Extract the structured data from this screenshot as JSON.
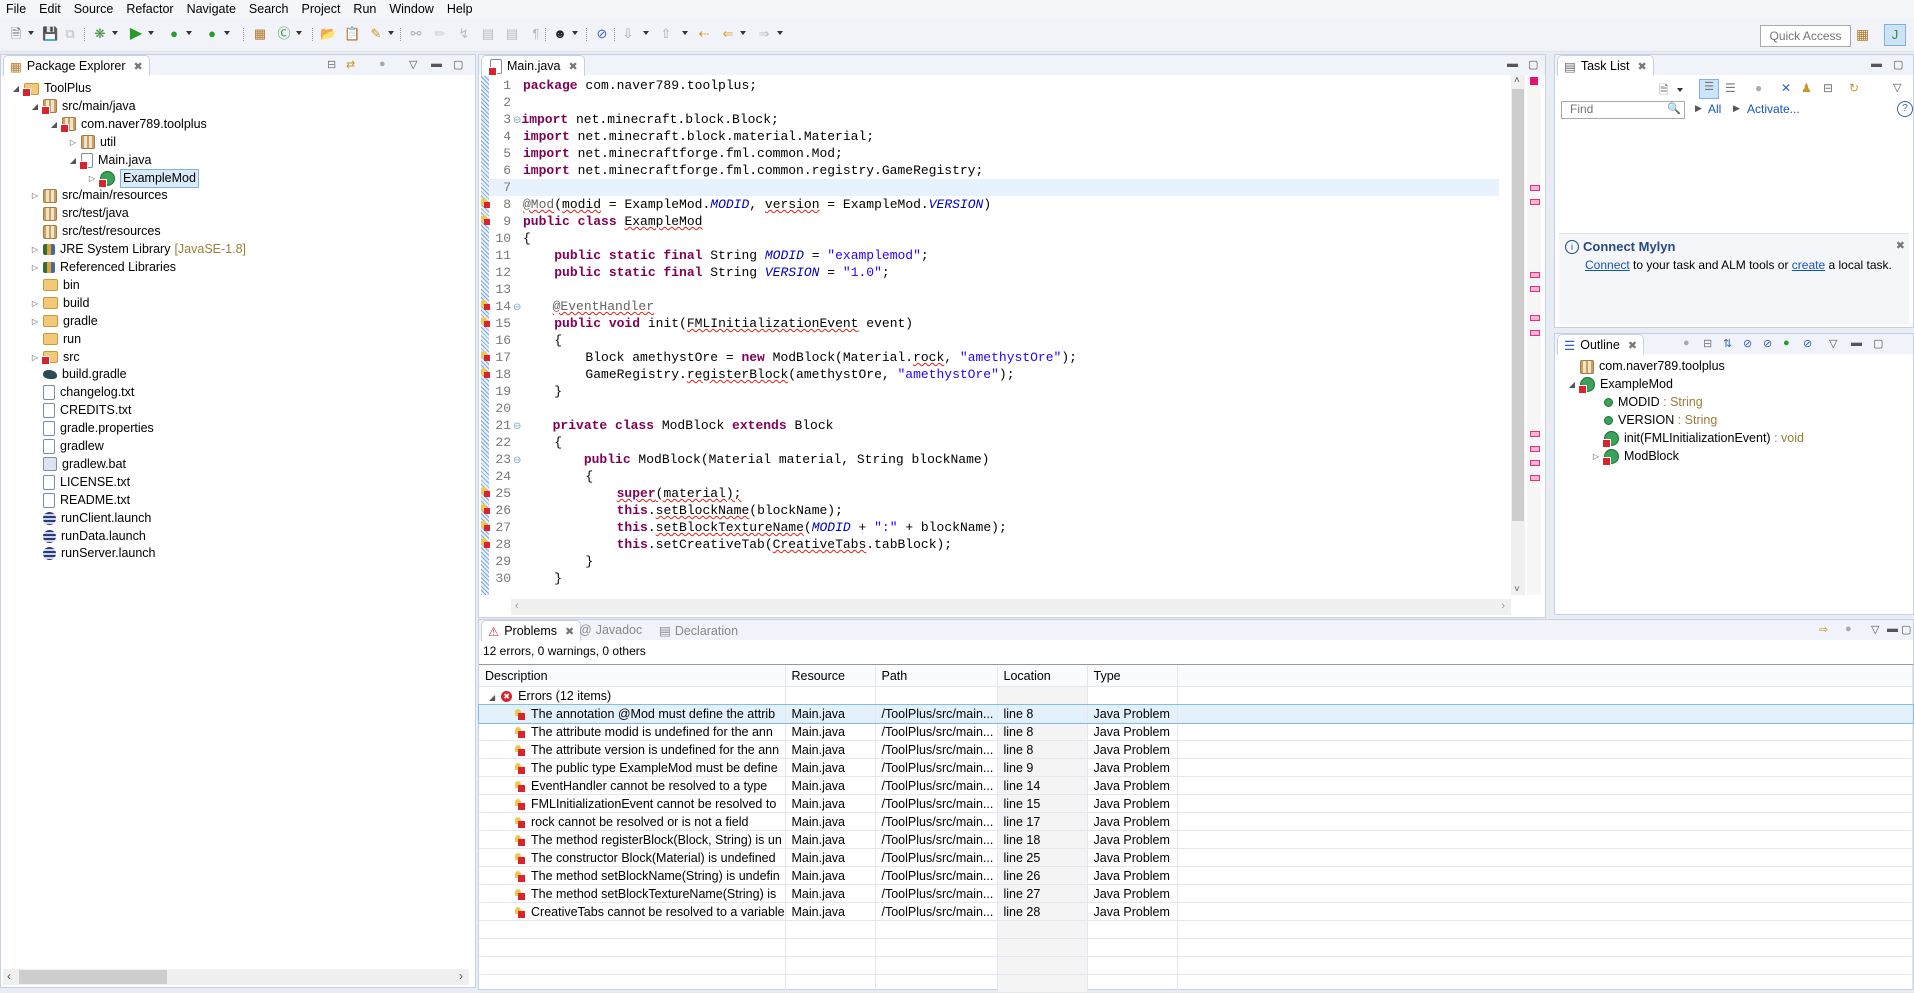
{
  "menu": [
    "File",
    "Edit",
    "Source",
    "Refactor",
    "Navigate",
    "Search",
    "Project",
    "Run",
    "Window",
    "Help"
  ],
  "toolbar": {
    "quick_access": "Quick Access"
  },
  "package_explorer": {
    "title": "Package Explorer",
    "tree": [
      {
        "label": "ToolPlus",
        "depth": 0,
        "toggle": "expanded",
        "icon": "project",
        "error": true
      },
      {
        "label": "src/main/java",
        "depth": 1,
        "toggle": "expanded",
        "icon": "pkg-folder",
        "error": true
      },
      {
        "label": "com.naver789.toolplus",
        "depth": 2,
        "toggle": "expanded",
        "icon": "package",
        "error": true
      },
      {
        "label": "util",
        "depth": 3,
        "toggle": "collapsed",
        "icon": "package",
        "error": false
      },
      {
        "label": "Main.java",
        "depth": 3,
        "toggle": "expanded",
        "icon": "java-file",
        "error": true
      },
      {
        "label": "ExampleMod",
        "depth": 4,
        "toggle": "collapsed",
        "icon": "class",
        "error": true,
        "selected": true
      },
      {
        "label": "src/main/resources",
        "depth": 1,
        "toggle": "collapsed",
        "icon": "pkg-folder",
        "error": false
      },
      {
        "label": "src/test/java",
        "depth": 1,
        "toggle": "none",
        "icon": "pkg-folder",
        "error": false
      },
      {
        "label": "src/test/resources",
        "depth": 1,
        "toggle": "none",
        "icon": "pkg-folder",
        "error": false
      },
      {
        "label": "JRE System Library",
        "decoration": "[JavaSE-1.8]",
        "depth": 1,
        "toggle": "collapsed",
        "icon": "library",
        "error": false
      },
      {
        "label": "Referenced Libraries",
        "depth": 1,
        "toggle": "collapsed",
        "icon": "library",
        "error": false
      },
      {
        "label": "bin",
        "depth": 1,
        "toggle": "none",
        "icon": "folder",
        "error": false
      },
      {
        "label": "build",
        "depth": 1,
        "toggle": "collapsed",
        "icon": "folder",
        "error": false
      },
      {
        "label": "gradle",
        "depth": 1,
        "toggle": "collapsed",
        "icon": "folder",
        "error": false
      },
      {
        "label": "run",
        "depth": 1,
        "toggle": "none",
        "icon": "folder",
        "error": false
      },
      {
        "label": "src",
        "depth": 1,
        "toggle": "collapsed",
        "icon": "folder",
        "error": true
      },
      {
        "label": "build.gradle",
        "depth": 1,
        "toggle": "none",
        "icon": "gradle",
        "error": false
      },
      {
        "label": "changelog.txt",
        "depth": 1,
        "toggle": "none",
        "icon": "text-file",
        "error": false
      },
      {
        "label": "CREDITS.txt",
        "depth": 1,
        "toggle": "none",
        "icon": "text-file",
        "error": false
      },
      {
        "label": "gradle.properties",
        "depth": 1,
        "toggle": "none",
        "icon": "text-file",
        "error": false
      },
      {
        "label": "gradlew",
        "depth": 1,
        "toggle": "none",
        "icon": "text-file",
        "error": false
      },
      {
        "label": "gradlew.bat",
        "depth": 1,
        "toggle": "none",
        "icon": "bat-file",
        "error": false
      },
      {
        "label": "LICENSE.txt",
        "depth": 1,
        "toggle": "none",
        "icon": "text-file",
        "error": false
      },
      {
        "label": "README.txt",
        "depth": 1,
        "toggle": "none",
        "icon": "text-file",
        "error": false
      },
      {
        "label": "runClient.launch",
        "depth": 1,
        "toggle": "none",
        "icon": "launch",
        "error": false
      },
      {
        "label": "runData.launch",
        "depth": 1,
        "toggle": "none",
        "icon": "launch",
        "error": false
      },
      {
        "label": "runServer.launch",
        "depth": 1,
        "toggle": "none",
        "icon": "launch",
        "error": false
      }
    ]
  },
  "editor": {
    "tab": "Main.java",
    "lines": [
      {
        "n": 1,
        "t": [
          [
            "kw",
            "package"
          ],
          [
            "",
            "com.naver789.toolplus;"
          ]
        ]
      },
      {
        "n": 2,
        "t": []
      },
      {
        "n": 3,
        "fold": true,
        "t": [
          [
            "kw",
            "import"
          ],
          [
            "",
            " net.minecraft.block.Block;"
          ]
        ]
      },
      {
        "n": 4,
        "t": [
          [
            "kw",
            "import"
          ],
          [
            "",
            " net.minecraft.block.material.Material;"
          ]
        ]
      },
      {
        "n": 5,
        "t": [
          [
            "kw",
            "import"
          ],
          [
            "",
            " net.minecraftforge.fml.common.Mod;"
          ]
        ]
      },
      {
        "n": 6,
        "t": [
          [
            "kw",
            "import"
          ],
          [
            "",
            " net.minecraftforge.fml.common.registry.GameRegistry;"
          ]
        ]
      },
      {
        "n": 7,
        "t": [],
        "current": true
      },
      {
        "n": 8,
        "err": true,
        "t": [
          [
            "ann sq",
            "@Mod"
          ],
          [
            "",
            "("
          ],
          [
            "sq",
            "modid"
          ],
          [
            "",
            " = ExampleMod."
          ],
          [
            "cst",
            "MODID"
          ],
          [
            "",
            ", "
          ],
          [
            "sq",
            "version"
          ],
          [
            "",
            " = ExampleMod."
          ],
          [
            "cst",
            "VERSION"
          ],
          [
            "",
            ")"
          ]
        ]
      },
      {
        "n": 9,
        "err": true,
        "t": [
          [
            "kw",
            "public class"
          ],
          [
            "",
            " "
          ],
          [
            "sq",
            "ExampleMod"
          ]
        ]
      },
      {
        "n": 10,
        "t": [
          [
            "",
            "{"
          ]
        ]
      },
      {
        "n": 11,
        "t": [
          [
            "",
            "    "
          ],
          [
            "kw",
            "public static final"
          ],
          [
            "",
            " String "
          ],
          [
            "cst",
            "MODID"
          ],
          [
            "",
            " = "
          ],
          [
            "str",
            "\"examplemod\""
          ],
          [
            "",
            ";"
          ]
        ]
      },
      {
        "n": 12,
        "t": [
          [
            "",
            "    "
          ],
          [
            "kw",
            "public static final"
          ],
          [
            "",
            " String "
          ],
          [
            "cst",
            "VERSION"
          ],
          [
            "",
            " = "
          ],
          [
            "str",
            "\"1.0\""
          ],
          [
            "",
            ";"
          ]
        ]
      },
      {
        "n": 13,
        "t": []
      },
      {
        "n": 14,
        "err": true,
        "fold": true,
        "t": [
          [
            "",
            "    "
          ],
          [
            "ann sq",
            "@EventHandler"
          ]
        ]
      },
      {
        "n": 15,
        "err": true,
        "t": [
          [
            "",
            "    "
          ],
          [
            "kw",
            "public void"
          ],
          [
            "",
            " init("
          ],
          [
            "sq",
            "FMLInitializationEvent"
          ],
          [
            "",
            " event)"
          ]
        ]
      },
      {
        "n": 16,
        "t": [
          [
            "",
            "    {"
          ]
        ]
      },
      {
        "n": 17,
        "err": true,
        "t": [
          [
            "",
            "        Block amethystOre = "
          ],
          [
            "kw",
            "new"
          ],
          [
            "",
            " ModBlock(Material."
          ],
          [
            "sq",
            "rock"
          ],
          [
            "",
            ", "
          ],
          [
            "str",
            "\"amethystOre\""
          ],
          [
            "",
            ");"
          ]
        ]
      },
      {
        "n": 18,
        "err": true,
        "t": [
          [
            "",
            "        GameRegistry."
          ],
          [
            "sq",
            "registerBlock"
          ],
          [
            "",
            "(amethystOre, "
          ],
          [
            "str",
            "\"amethystOre\""
          ],
          [
            "",
            ");"
          ]
        ]
      },
      {
        "n": 19,
        "t": [
          [
            "",
            "    }"
          ]
        ]
      },
      {
        "n": 20,
        "t": []
      },
      {
        "n": 21,
        "fold": true,
        "t": [
          [
            "",
            "    "
          ],
          [
            "kw",
            "private class"
          ],
          [
            "",
            " ModBlock "
          ],
          [
            "kw",
            "extends"
          ],
          [
            "",
            " Block"
          ]
        ]
      },
      {
        "n": 22,
        "t": [
          [
            "",
            "    {"
          ]
        ]
      },
      {
        "n": 23,
        "fold": true,
        "t": [
          [
            "",
            "        "
          ],
          [
            "kw",
            "public"
          ],
          [
            "",
            " ModBlock(Material material, String blockName)"
          ]
        ]
      },
      {
        "n": 24,
        "t": [
          [
            "",
            "        {"
          ]
        ]
      },
      {
        "n": 25,
        "err": true,
        "t": [
          [
            "",
            "            "
          ],
          [
            "kw sq",
            "super"
          ],
          [
            "sq",
            "(material);"
          ]
        ]
      },
      {
        "n": 26,
        "err": true,
        "t": [
          [
            "",
            "            "
          ],
          [
            "kw",
            "this"
          ],
          [
            "",
            "."
          ],
          [
            "sq",
            "setBlockName"
          ],
          [
            "",
            "(blockName);"
          ]
        ]
      },
      {
        "n": 27,
        "err": true,
        "t": [
          [
            "",
            "            "
          ],
          [
            "kw",
            "this"
          ],
          [
            "",
            "."
          ],
          [
            "sq",
            "setBlockTextureName"
          ],
          [
            "",
            "("
          ],
          [
            "cst",
            "MODID"
          ],
          [
            "",
            " + "
          ],
          [
            "str",
            "\":\""
          ],
          [
            "",
            " + blockName);"
          ]
        ]
      },
      {
        "n": 28,
        "err": true,
        "t": [
          [
            "",
            "            "
          ],
          [
            "kw",
            "this"
          ],
          [
            "",
            ".setCreativeTab("
          ],
          [
            "sq",
            "CreativeTabs"
          ],
          [
            "",
            ".tabBlock);"
          ]
        ]
      },
      {
        "n": 29,
        "t": [
          [
            "",
            "        }"
          ]
        ]
      },
      {
        "n": 30,
        "t": [
          [
            "",
            "    }"
          ]
        ]
      }
    ]
  },
  "task_list": {
    "title": "Task List",
    "find_placeholder": "Find",
    "all_label": "All",
    "activate_label": "Activate...",
    "mylyn_title": "Connect Mylyn",
    "mylyn_connect": "Connect",
    "mylyn_mid": " to your task and ALM tools or ",
    "mylyn_create": "create",
    "mylyn_end": " a local task."
  },
  "outline": {
    "title": "Outline",
    "items": [
      {
        "label": "com.naver789.toolplus",
        "type": "",
        "depth": 0,
        "icon": "package"
      },
      {
        "label": "ExampleMod",
        "type": "",
        "depth": 0,
        "icon": "class",
        "toggle": "expanded",
        "error": true
      },
      {
        "label": "MODID",
        "type": " : String",
        "depth": 1,
        "icon": "static-final-field"
      },
      {
        "label": "VERSION",
        "type": " : String",
        "depth": 1,
        "icon": "static-final-field"
      },
      {
        "label": "init(FMLInitializationEvent)",
        "type": " : void",
        "depth": 1,
        "icon": "method",
        "error": true
      },
      {
        "label": "ModBlock",
        "type": "",
        "depth": 1,
        "icon": "inner-class",
        "toggle": "collapsed",
        "error": true
      }
    ]
  },
  "problems": {
    "tabs": [
      "Problems",
      "Javadoc",
      "Declaration"
    ],
    "summary": "12 errors, 0 warnings, 0 others",
    "columns": [
      "Description",
      "Resource",
      "Path",
      "Location",
      "Type"
    ],
    "group": "Errors (12 items)",
    "rows": [
      [
        "The annotation @Mod must define the attrib",
        "Main.java",
        "/ToolPlus/src/main...",
        "line 8",
        "Java Problem"
      ],
      [
        "The attribute modid is undefined for the ann",
        "Main.java",
        "/ToolPlus/src/main...",
        "line 8",
        "Java Problem"
      ],
      [
        "The attribute version is undefined for the ann",
        "Main.java",
        "/ToolPlus/src/main...",
        "line 8",
        "Java Problem"
      ],
      [
        "The public type ExampleMod must be define",
        "Main.java",
        "/ToolPlus/src/main...",
        "line 9",
        "Java Problem"
      ],
      [
        "EventHandler cannot be resolved to a type",
        "Main.java",
        "/ToolPlus/src/main...",
        "line 14",
        "Java Problem"
      ],
      [
        "FMLInitializationEvent cannot be resolved to",
        "Main.java",
        "/ToolPlus/src/main...",
        "line 15",
        "Java Problem"
      ],
      [
        "rock cannot be resolved or is not a field",
        "Main.java",
        "/ToolPlus/src/main...",
        "line 17",
        "Java Problem"
      ],
      [
        "The method registerBlock(Block, String) is un",
        "Main.java",
        "/ToolPlus/src/main...",
        "line 18",
        "Java Problem"
      ],
      [
        "The constructor Block(Material) is undefined",
        "Main.java",
        "/ToolPlus/src/main...",
        "line 25",
        "Java Problem"
      ],
      [
        "The method setBlockName(String) is undefin",
        "Main.java",
        "/ToolPlus/src/main...",
        "line 26",
        "Java Problem"
      ],
      [
        "The method setBlockTextureName(String) is",
        "Main.java",
        "/ToolPlus/src/main...",
        "line 27",
        "Java Problem"
      ],
      [
        "CreativeTabs cannot be resolved to a variable",
        "Main.java",
        "/ToolPlus/src/main...",
        "line 28",
        "Java Problem"
      ]
    ]
  }
}
